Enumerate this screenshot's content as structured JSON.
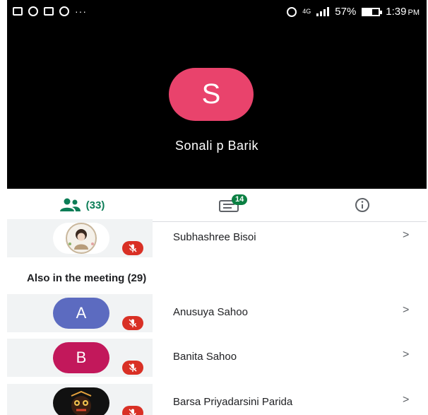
{
  "status_bar": {
    "network": "4G",
    "battery": "57%",
    "battery_level": 0.57,
    "time": "1:39",
    "time_suffix": "PM",
    "overflow": "···"
  },
  "speaker": {
    "initial": "S",
    "name": "Sonali p Barik",
    "color": "#e9436c"
  },
  "tabs": {
    "people_count": "(33)",
    "chat_badge": "14",
    "accent": "#0b7d56"
  },
  "pinned": [
    {
      "name": "Subhashree Bisoi",
      "avatar": "photo",
      "muted": true
    }
  ],
  "section": {
    "title": "Also in the meeting (29)"
  },
  "participants": [
    {
      "initial": "A",
      "name": "Anusuya Sahoo",
      "color": "#5c6bc0",
      "muted": true
    },
    {
      "initial": "B",
      "name": "Banita Sahoo",
      "color": "#c2185b",
      "muted": true
    },
    {
      "initial": "",
      "name": "Barsa Priyadarsini Parida",
      "color": "#111111",
      "muted": true
    }
  ],
  "chevron": ">",
  "icons": {
    "mute": "mic-off-icon",
    "people": "people-icon",
    "chat": "chat-icon",
    "info": "info-icon"
  }
}
